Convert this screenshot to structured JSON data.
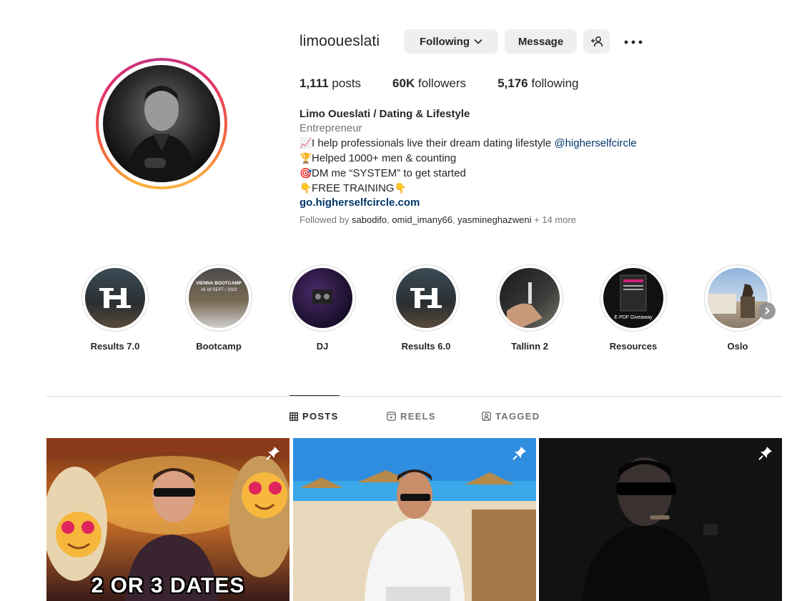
{
  "profile": {
    "username": "limooueslati",
    "following_label": "Following",
    "message_label": "Message",
    "stats": {
      "posts_count": "1,111",
      "posts_label": "posts",
      "followers_count": "60K",
      "followers_label": "followers",
      "following_count": "5,176",
      "following_label": "following"
    },
    "bio": {
      "name": "Limo Oueslati / Dating & Lifestyle",
      "category": "Entrepreneur",
      "line1_text": "I help professionals live their dream dating lifestyle",
      "line1_mention": "@higherselfcircle",
      "line2_text": "Helped 1000+ men & counting",
      "line3_text": "DM me “SYSTEM” to get started",
      "line4_text": "FREE TRAINING",
      "link": "go.higherselfcircle.com"
    },
    "followed_by": {
      "prefix": "Followed by",
      "users": [
        "sabodifo",
        "omid_imany66",
        "yasmineghazweni"
      ],
      "more": "+ 14 more"
    }
  },
  "highlights": [
    {
      "label": "Results 7.0"
    },
    {
      "label": "Bootcamp",
      "overlay_top": "VIENNA BOOTCAMP",
      "overlay_date": "16-18 SEPT / 2023"
    },
    {
      "label": "DJ"
    },
    {
      "label": "Results 6.0"
    },
    {
      "label": "Tallinn 2"
    },
    {
      "label": "Resources",
      "overlay_bottom": "E PDF Giveaway"
    },
    {
      "label": "Oslo"
    }
  ],
  "tabs": {
    "posts": "POSTS",
    "reels": "REELS",
    "tagged": "TAGGED"
  },
  "posts": [
    {
      "caption": "2 OR 3 DATES"
    },
    {
      "caption": ""
    },
    {
      "caption": ""
    }
  ],
  "colors": {
    "link": "#00376b",
    "button_bg": "#efefef",
    "text": "#262626",
    "muted": "#737373"
  }
}
